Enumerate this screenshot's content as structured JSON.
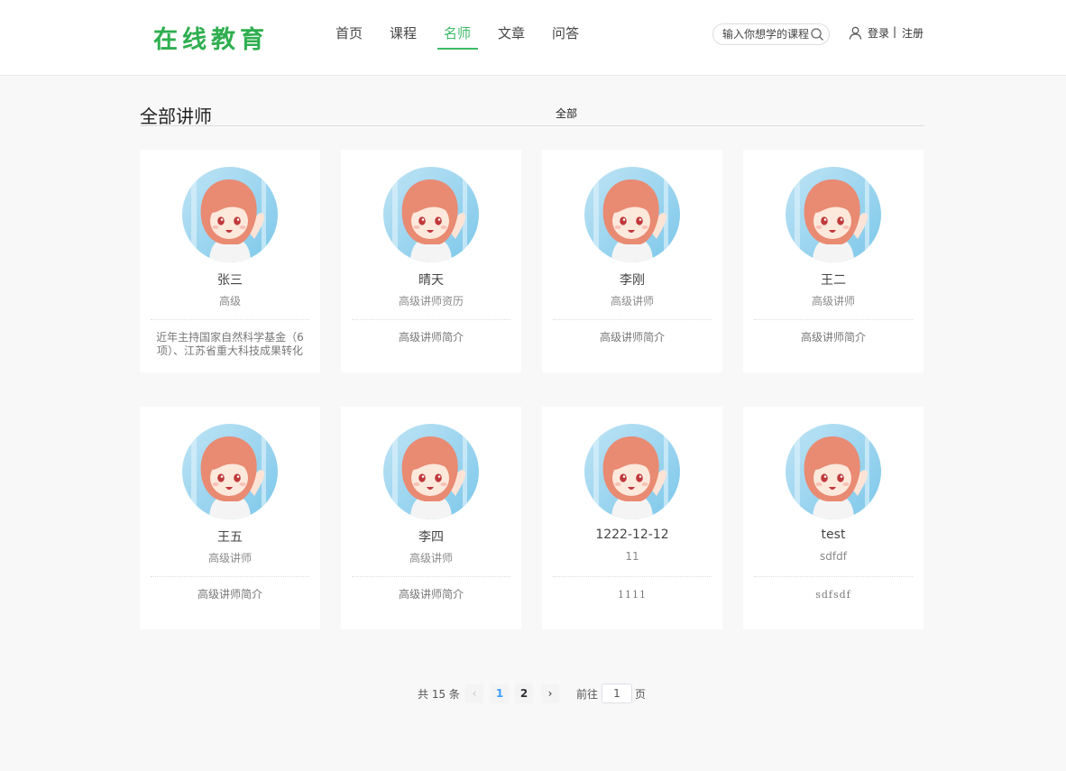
{
  "header": {
    "logo": "在线教育",
    "nav": [
      "首页",
      "课程",
      "名师",
      "文章",
      "问答"
    ],
    "active_nav": "名师",
    "search_placeholder": "输入你想学的课程",
    "login": "登录",
    "divider": "|",
    "register": "注册",
    "accent_color": "#3dbb68"
  },
  "section": {
    "title": "全部讲师",
    "filter": "全部"
  },
  "teachers": [
    {
      "name": "张三",
      "title": "高级",
      "intro": "近年主持国家自然科学基金（6项）、江苏省重大科技成果转化"
    },
    {
      "name": "晴天",
      "title": "高级讲师资历",
      "intro": "高级讲师简介"
    },
    {
      "name": "李刚",
      "title": "高级讲师",
      "intro": "高级讲师简介"
    },
    {
      "name": "王二",
      "title": "高级讲师",
      "intro": "高级讲师简介"
    },
    {
      "name": "王五",
      "title": "高级讲师",
      "intro": "高级讲师简介"
    },
    {
      "name": "李四",
      "title": "高级讲师",
      "intro": "高级讲师简介"
    },
    {
      "name": "1222-12-12",
      "title": "11",
      "intro": "1111"
    },
    {
      "name": "test",
      "title": "sdfdf",
      "intro": "sdfsdf"
    }
  ],
  "pagination": {
    "total": "共 15 条",
    "pages": [
      "1",
      "2"
    ],
    "current": "1",
    "goto_label": "前往",
    "goto_value": "1",
    "goto_suffix": "页"
  }
}
